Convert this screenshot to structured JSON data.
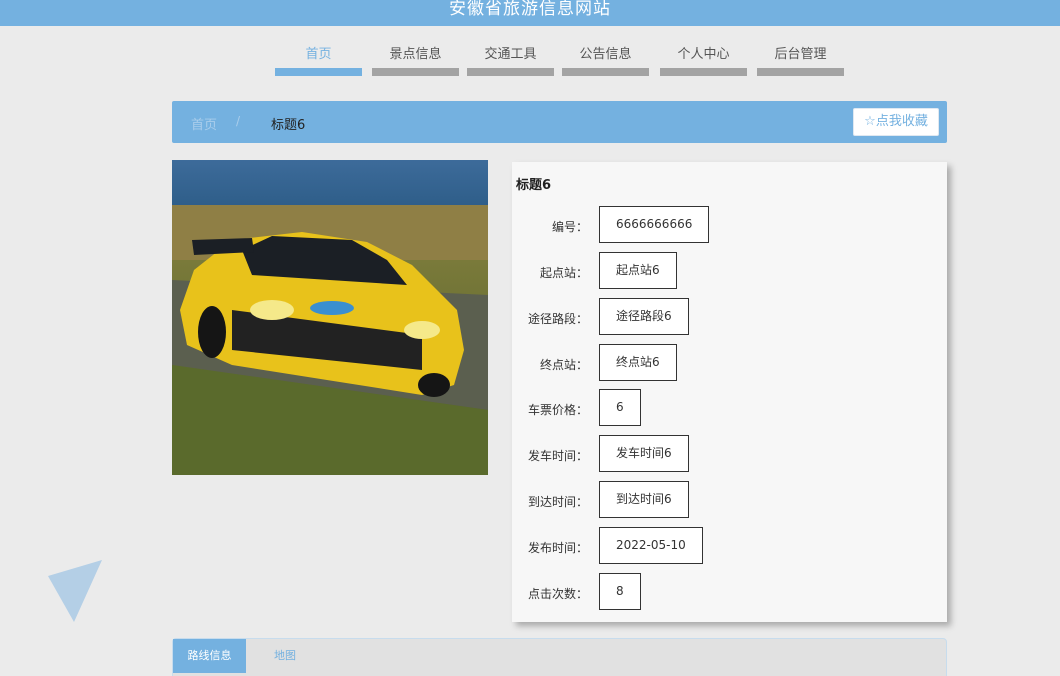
{
  "site": {
    "title": "安徽省旅游信息网站"
  },
  "nav": {
    "items": [
      {
        "label": "首页",
        "active": true
      },
      {
        "label": "景点信息",
        "active": false
      },
      {
        "label": "交通工具",
        "active": false
      },
      {
        "label": "公告信息",
        "active": false
      },
      {
        "label": "个人中心",
        "active": false
      },
      {
        "label": "后台管理",
        "active": false
      }
    ]
  },
  "breadcrumb": {
    "home": "首页",
    "separator": "/",
    "current": "标题6"
  },
  "favorite_button": {
    "icon": "star-outline-icon",
    "label": "点我收藏"
  },
  "image": {
    "subject": "yellow-race-car"
  },
  "detail": {
    "title": "标题6",
    "fields": [
      {
        "label": "编号：",
        "value": "6666666666"
      },
      {
        "label": "起点站：",
        "value": "起点站6"
      },
      {
        "label": "途径路段：",
        "value": "途径路段6"
      },
      {
        "label": "终点站：",
        "value": "终点站6"
      },
      {
        "label": "车票价格：",
        "value": "6"
      },
      {
        "label": "发车时间：",
        "value": "发车时间6"
      },
      {
        "label": "到达时间：",
        "value": "到达时间6"
      },
      {
        "label": "发布时间：",
        "value": "2022-05-10"
      },
      {
        "label": "点击次数：",
        "value": "8"
      }
    ]
  },
  "tabs": [
    {
      "label": "路线信息",
      "active": true
    },
    {
      "label": "地图",
      "active": false
    }
  ],
  "colors": {
    "accent": "#74b1e0",
    "nav_inactive_bar": "#a3a3a3",
    "background": "#ebebeb"
  }
}
